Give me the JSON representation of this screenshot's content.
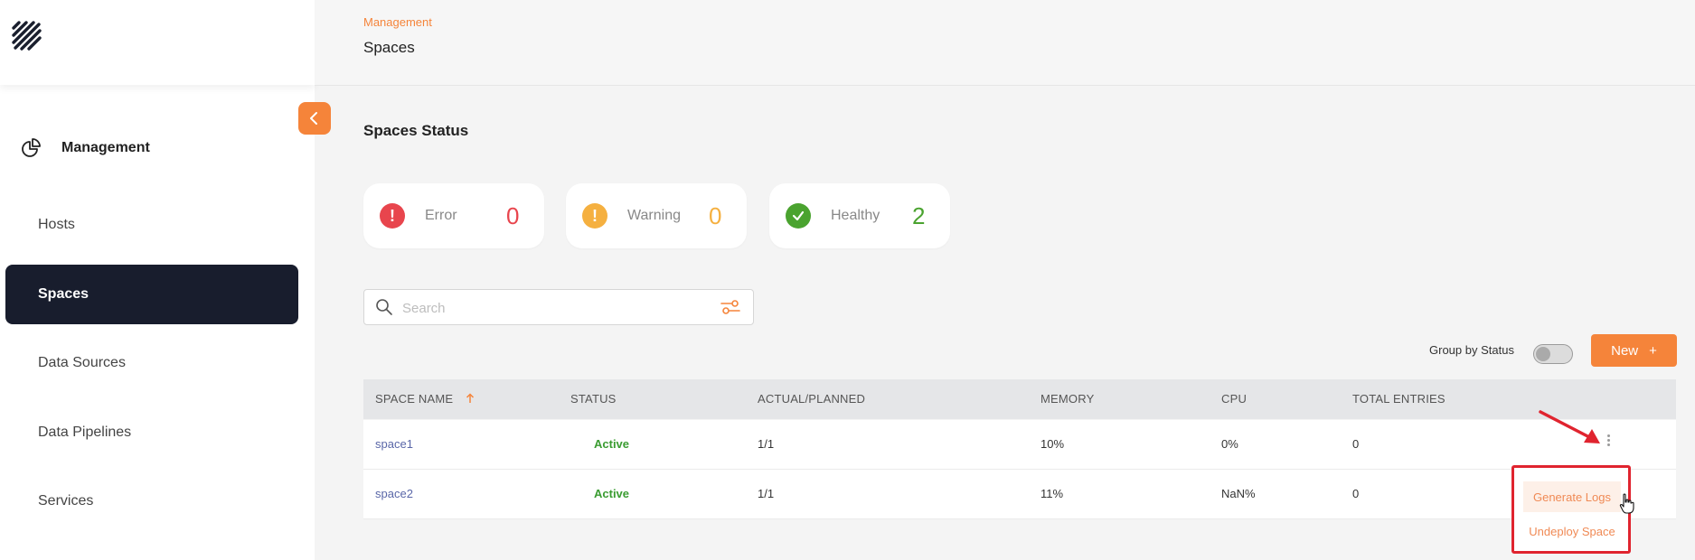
{
  "header": {
    "breadcrumb": "Management",
    "title": "Spaces"
  },
  "sidebar": {
    "section_label": "Management",
    "items": [
      {
        "label": "Hosts",
        "active": false
      },
      {
        "label": "Spaces",
        "active": true
      },
      {
        "label": "Data Sources",
        "active": false
      },
      {
        "label": "Data Pipelines",
        "active": false
      },
      {
        "label": "Services",
        "active": false
      }
    ]
  },
  "status_section": {
    "title": "Spaces Status",
    "cards": [
      {
        "label": "Error",
        "count": "0",
        "color": "#e8454d",
        "icon": "exclamation-icon"
      },
      {
        "label": "Warning",
        "count": "0",
        "color": "#f5b040",
        "icon": "exclamation-icon"
      },
      {
        "label": "Healthy",
        "count": "2",
        "color": "#4aa32f",
        "icon": "check-icon"
      }
    ]
  },
  "search": {
    "placeholder": "Search",
    "value": ""
  },
  "toolbar": {
    "group_by_label": "Group by Status",
    "group_by_enabled": false,
    "new_label": "New",
    "new_icon": "+"
  },
  "table": {
    "columns": [
      "SPACE NAME",
      "STATUS",
      "ACTUAL/PLANNED",
      "MEMORY",
      "CPU",
      "TOTAL ENTRIES"
    ],
    "sort_column": "SPACE NAME",
    "sort_direction": "ascending",
    "rows": [
      {
        "name": "space1",
        "status": "Active",
        "actual_planned": "1/1",
        "memory": "10%",
        "cpu": "0%",
        "total_entries": "0"
      },
      {
        "name": "space2",
        "status": "Active",
        "actual_planned": "1/1",
        "memory": "11%",
        "cpu": "NaN%",
        "total_entries": "0"
      }
    ]
  },
  "row_menu": {
    "items": [
      "Generate Logs",
      "Undeploy Space"
    ]
  },
  "colors": {
    "accent": "#f5843a",
    "sidebar_active_bg": "#181d2d",
    "status_active": "#3a9c31",
    "link": "#5a67a8",
    "highlight_border": "#e0242f"
  }
}
